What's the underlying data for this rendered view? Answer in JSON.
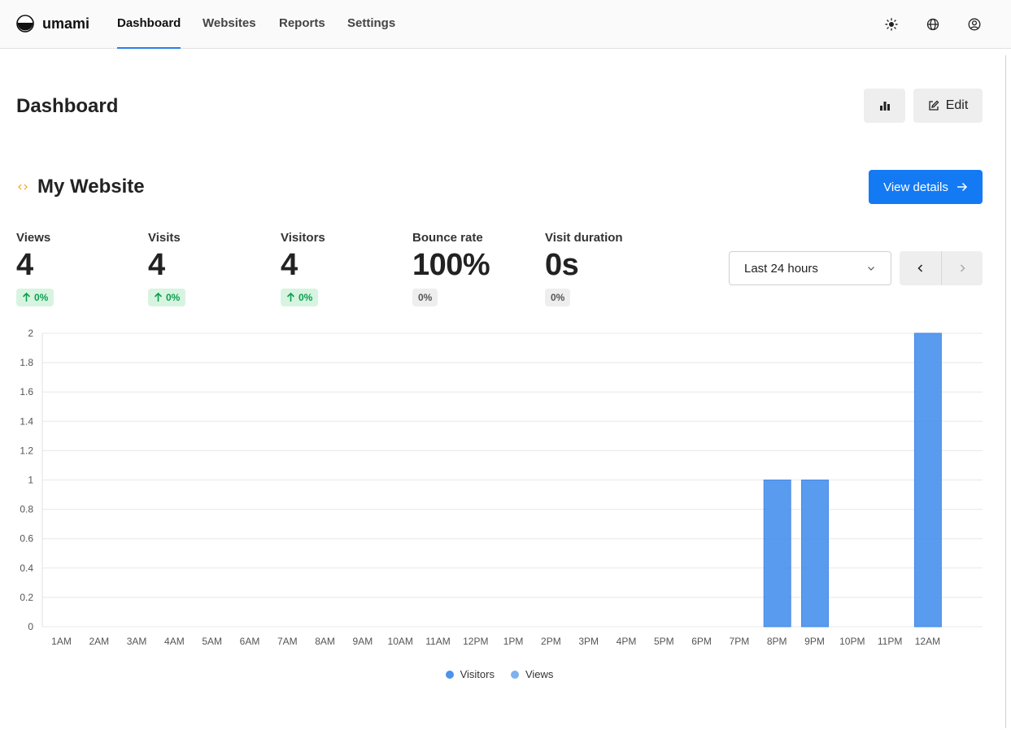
{
  "app": {
    "brand": "umami"
  },
  "nav": {
    "items": [
      {
        "label": "Dashboard",
        "active": true
      },
      {
        "label": "Websites",
        "active": false
      },
      {
        "label": "Reports",
        "active": false
      },
      {
        "label": "Settings",
        "active": false
      }
    ],
    "icons": [
      "theme-toggle-icon",
      "language-icon",
      "profile-icon"
    ]
  },
  "page": {
    "title": "Dashboard",
    "edit_label": "Edit"
  },
  "website": {
    "name": "My Website",
    "view_details_label": "View details"
  },
  "metrics": [
    {
      "label": "Views",
      "value": "4",
      "change": "0%",
      "trend": "up"
    },
    {
      "label": "Visits",
      "value": "4",
      "change": "0%",
      "trend": "up"
    },
    {
      "label": "Visitors",
      "value": "4",
      "change": "0%",
      "trend": "up"
    },
    {
      "label": "Bounce rate",
      "value": "100%",
      "change": "0%",
      "trend": "neutral"
    },
    {
      "label": "Visit duration",
      "value": "0s",
      "change": "0%",
      "trend": "neutral"
    }
  ],
  "date_range": {
    "selected": "Last 24 hours"
  },
  "colors": {
    "accent": "#2680eb",
    "primary_button": "#147af3",
    "visitors": "#4c93ee",
    "views": "#7fb0f2",
    "badge_up_bg": "#d7f4e1",
    "badge_up_text": "#0d9f4f"
  },
  "chart_data": {
    "type": "bar",
    "categories": [
      "1AM",
      "2AM",
      "3AM",
      "4AM",
      "5AM",
      "6AM",
      "7AM",
      "8AM",
      "9AM",
      "10AM",
      "11AM",
      "12PM",
      "1PM",
      "2PM",
      "3PM",
      "4PM",
      "5PM",
      "6PM",
      "7PM",
      "8PM",
      "9PM",
      "10PM",
      "11PM",
      "12AM"
    ],
    "series": [
      {
        "name": "Visitors",
        "color": "#4c93ee",
        "values": [
          0,
          0,
          0,
          0,
          0,
          0,
          0,
          0,
          0,
          0,
          0,
          0,
          0,
          0,
          0,
          0,
          0,
          0,
          0,
          1,
          1,
          0,
          0,
          2
        ]
      },
      {
        "name": "Views",
        "color": "#7fb0f2",
        "values": [
          0,
          0,
          0,
          0,
          0,
          0,
          0,
          0,
          0,
          0,
          0,
          0,
          0,
          0,
          0,
          0,
          0,
          0,
          0,
          1,
          1,
          0,
          0,
          2
        ]
      }
    ],
    "yticks": [
      "0",
      "0.2",
      "0.4",
      "0.6",
      "0.8",
      "1",
      "1.2",
      "1.4",
      "1.6",
      "1.8",
      "2"
    ],
    "ylim": [
      0,
      2
    ],
    "grid": true,
    "legend_position": "bottom-center"
  }
}
